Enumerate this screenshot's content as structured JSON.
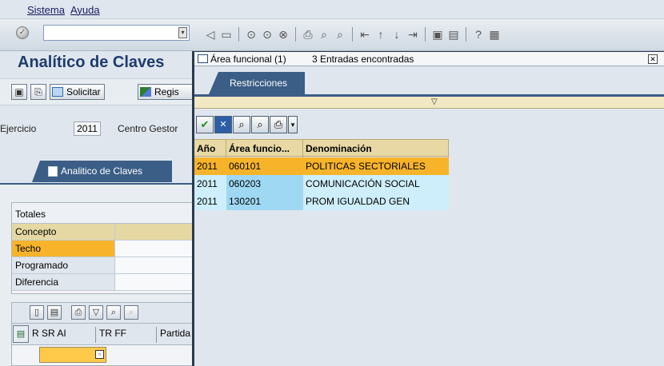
{
  "menu": {
    "items": [
      "Sistema",
      "Ayuda"
    ]
  },
  "toolbar": {
    "command_value": "",
    "icons": [
      "back-icon",
      "save-icon",
      "sep",
      "nav-back-icon",
      "nav-exit-icon",
      "cancel-icon",
      "sep",
      "print-icon",
      "find-icon",
      "find-next-icon",
      "sep",
      "first-page-icon",
      "prev-page-icon",
      "next-page-icon",
      "last-page-icon",
      "sep",
      "new-session-icon",
      "shortcut-icon",
      "sep",
      "help-icon",
      "layout-icon"
    ]
  },
  "main": {
    "title": "Analítico de Claves",
    "buttons": {
      "solicitar": "Solicitar",
      "registrar": "Regis"
    },
    "ejercicio_label": "Ejercicio",
    "ejercicio_value": "2011",
    "centro_label": "Centro Gestor",
    "tab_label": "Analitico de Claves",
    "totales": {
      "title": "Totales",
      "header": "Concepto",
      "rows": [
        "Techo",
        "Programado",
        "Diferencia"
      ]
    },
    "table_columns": [
      "R SR AI",
      "TR FF",
      "Partida"
    ]
  },
  "dialog": {
    "title": "Área funcional (1)",
    "entries": "3 Entradas encontradas",
    "tab": "Restricciones",
    "columns": [
      "Año",
      "Área funcio...",
      "Denominación"
    ],
    "rows": [
      {
        "anio": "2011",
        "area": "060101",
        "denom": "POLITICAS SECTORIALES"
      },
      {
        "anio": "2011",
        "area": "060203",
        "denom": "COMUNICACIÓN SOCIAL"
      },
      {
        "anio": "2011",
        "area": "130201",
        "denom": "PROM IGUALDAD GEN"
      }
    ]
  },
  "colors": {
    "selection": "#f7b42a",
    "tab_blue": "#3b5e86",
    "row_blue": "#cdeefa",
    "header_tan": "#e8d9a4"
  }
}
